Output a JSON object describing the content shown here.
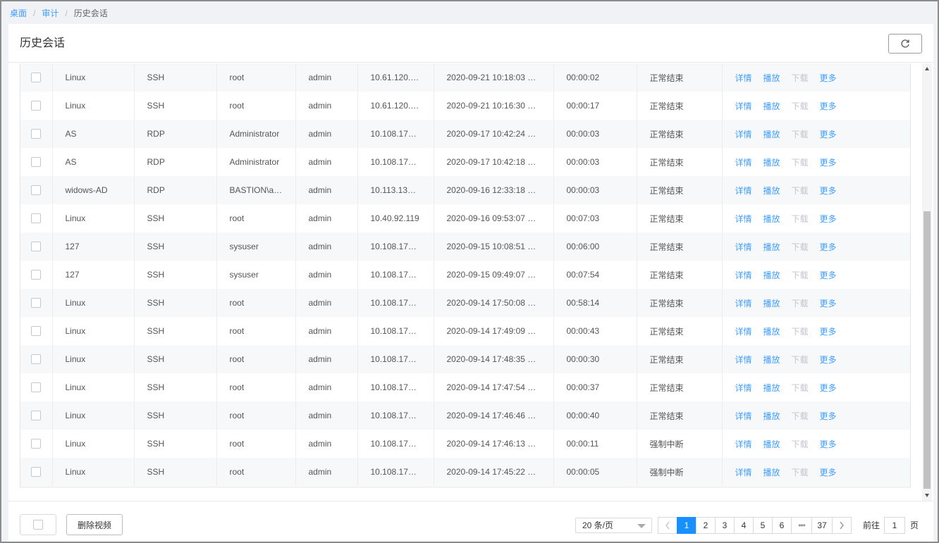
{
  "breadcrumb": {
    "home": "桌面",
    "section": "审计",
    "current": "历史会话",
    "separator": "/"
  },
  "page": {
    "title": "历史会话"
  },
  "table": {
    "actions": {
      "detail": "详情",
      "play": "播放",
      "download": "下载",
      "more": "更多"
    },
    "rows": [
      {
        "asset": "Linux",
        "protocol": "SSH",
        "account": "root",
        "user": "admin",
        "ip": "10.61.120.…",
        "start": "2020-09-21 10:18:03 …",
        "duration": "00:00:02",
        "status": "正常结束"
      },
      {
        "asset": "Linux",
        "protocol": "SSH",
        "account": "root",
        "user": "admin",
        "ip": "10.61.120.…",
        "start": "2020-09-21 10:16:30 …",
        "duration": "00:00:17",
        "status": "正常结束"
      },
      {
        "asset": "AS",
        "protocol": "RDP",
        "account": "Administrator",
        "user": "admin",
        "ip": "10.108.17…",
        "start": "2020-09-17 10:42:24 …",
        "duration": "00:00:03",
        "status": "正常结束"
      },
      {
        "asset": "AS",
        "protocol": "RDP",
        "account": "Administrator",
        "user": "admin",
        "ip": "10.108.17…",
        "start": "2020-09-17 10:42:18 …",
        "duration": "00:00:03",
        "status": "正常结束"
      },
      {
        "asset": "widows-AD",
        "protocol": "RDP",
        "account": "BASTION\\a…",
        "user": "admin",
        "ip": "10.113.13…",
        "start": "2020-09-16 12:33:18 …",
        "duration": "00:00:03",
        "status": "正常结束"
      },
      {
        "asset": "Linux",
        "protocol": "SSH",
        "account": "root",
        "user": "admin",
        "ip": "10.40.92.119",
        "start": "2020-09-16 09:53:07 …",
        "duration": "00:07:03",
        "status": "正常结束"
      },
      {
        "asset": "127",
        "protocol": "SSH",
        "account": "sysuser",
        "user": "admin",
        "ip": "10.108.17…",
        "start": "2020-09-15 10:08:51 …",
        "duration": "00:06:00",
        "status": "正常结束"
      },
      {
        "asset": "127",
        "protocol": "SSH",
        "account": "sysuser",
        "user": "admin",
        "ip": "10.108.17…",
        "start": "2020-09-15 09:49:07 …",
        "duration": "00:07:54",
        "status": "正常结束"
      },
      {
        "asset": "Linux",
        "protocol": "SSH",
        "account": "root",
        "user": "admin",
        "ip": "10.108.17…",
        "start": "2020-09-14 17:50:08 …",
        "duration": "00:58:14",
        "status": "正常结束"
      },
      {
        "asset": "Linux",
        "protocol": "SSH",
        "account": "root",
        "user": "admin",
        "ip": "10.108.17…",
        "start": "2020-09-14 17:49:09 …",
        "duration": "00:00:43",
        "status": "正常结束"
      },
      {
        "asset": "Linux",
        "protocol": "SSH",
        "account": "root",
        "user": "admin",
        "ip": "10.108.17…",
        "start": "2020-09-14 17:48:35 …",
        "duration": "00:00:30",
        "status": "正常结束"
      },
      {
        "asset": "Linux",
        "protocol": "SSH",
        "account": "root",
        "user": "admin",
        "ip": "10.108.17…",
        "start": "2020-09-14 17:47:54 …",
        "duration": "00:00:37",
        "status": "正常结束"
      },
      {
        "asset": "Linux",
        "protocol": "SSH",
        "account": "root",
        "user": "admin",
        "ip": "10.108.17…",
        "start": "2020-09-14 17:46:46 …",
        "duration": "00:00:40",
        "status": "正常结束"
      },
      {
        "asset": "Linux",
        "protocol": "SSH",
        "account": "root",
        "user": "admin",
        "ip": "10.108.17…",
        "start": "2020-09-14 17:46:13 …",
        "duration": "00:00:11",
        "status": "强制中断"
      },
      {
        "asset": "Linux",
        "protocol": "SSH",
        "account": "root",
        "user": "admin",
        "ip": "10.108.17…",
        "start": "2020-09-14 17:45:22 …",
        "duration": "00:00:05",
        "status": "强制中断"
      }
    ]
  },
  "footer": {
    "delete_label": "删除视频",
    "page_size": "20 条/页",
    "pages": [
      "1",
      "2",
      "3",
      "4",
      "5",
      "6"
    ],
    "ellipsis": "•••",
    "last_page": "37",
    "current_page": "1",
    "goto_label": "前往",
    "goto_value": "1",
    "goto_suffix": "页"
  },
  "colors": {
    "accent": "#1890ff",
    "link": "#409eff",
    "disabled": "#c0c4cc"
  }
}
